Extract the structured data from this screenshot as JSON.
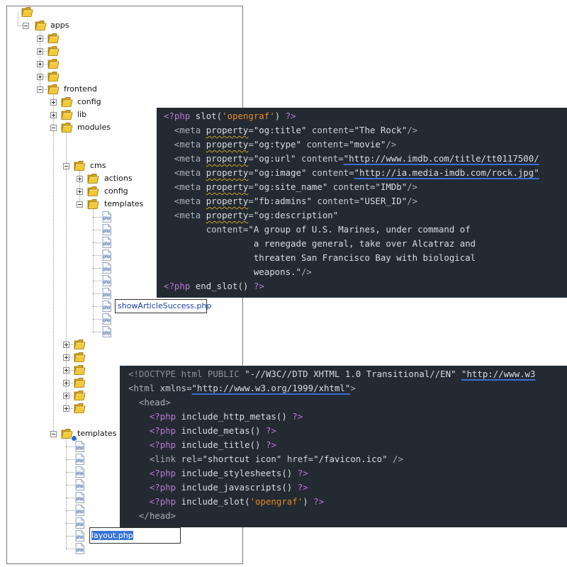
{
  "tree": {
    "root": {
      "icon": "folder-icon"
    },
    "apps": {
      "label": "apps"
    },
    "frontend": {
      "label": "frontend"
    },
    "config": {
      "label": "config"
    },
    "lib": {
      "label": "lib"
    },
    "modules": {
      "label": "modules"
    },
    "cms": {
      "label": "cms"
    },
    "actions": {
      "label": "actions"
    },
    "cms_config": {
      "label": "config"
    },
    "templates": {
      "label": "templates"
    },
    "app_templates": {
      "label": "templates"
    },
    "file_icon_text": "php",
    "edit_show": {
      "value": "showArticleSuccess.php"
    },
    "edit_layout": {
      "value": "layout.php",
      "prefix": "l"
    }
  },
  "code_top": {
    "lines": [
      [
        [
          "kw",
          "<?php"
        ],
        [
          "plain",
          " slot("
        ],
        [
          "str",
          "'opengraf'"
        ],
        [
          "plain",
          ") "
        ],
        [
          "kw",
          "?>"
        ]
      ],
      [
        [
          "plain",
          "  "
        ],
        [
          "tag",
          "<meta "
        ],
        [
          "sq",
          "property"
        ],
        [
          "attr",
          "="
        ],
        [
          "val",
          "\"og:title\""
        ],
        [
          "attr",
          " content="
        ],
        [
          "val",
          "\"The Rock\""
        ],
        [
          "tag",
          "/>"
        ]
      ],
      [
        [
          "plain",
          "  "
        ],
        [
          "tag",
          "<meta "
        ],
        [
          "sq",
          "property"
        ],
        [
          "attr",
          "="
        ],
        [
          "val",
          "\"og:type\""
        ],
        [
          "attr",
          " content="
        ],
        [
          "val",
          "\"movie\""
        ],
        [
          "tag",
          "/>"
        ]
      ],
      [
        [
          "plain",
          "  "
        ],
        [
          "tag",
          "<meta "
        ],
        [
          "sq",
          "property"
        ],
        [
          "attr",
          "="
        ],
        [
          "val",
          "\"og:url\""
        ],
        [
          "attr",
          " content="
        ],
        [
          "url",
          "\"http://www.imdb.com/title/tt0117500/"
        ]
      ],
      [
        [
          "plain",
          "  "
        ],
        [
          "tag",
          "<meta "
        ],
        [
          "sq",
          "property"
        ],
        [
          "attr",
          "="
        ],
        [
          "val",
          "\"og:image\""
        ],
        [
          "attr",
          " content="
        ],
        [
          "url",
          "\"http://ia.media-imdb.com/rock.jpg\""
        ]
      ],
      [
        [
          "plain",
          "  "
        ],
        [
          "tag",
          "<meta "
        ],
        [
          "sq",
          "property"
        ],
        [
          "attr",
          "="
        ],
        [
          "val",
          "\"og:site_name\""
        ],
        [
          "attr",
          " content="
        ],
        [
          "val",
          "\"IMDb\""
        ],
        [
          "tag",
          "/>"
        ]
      ],
      [
        [
          "plain",
          "  "
        ],
        [
          "tag",
          "<meta "
        ],
        [
          "sq",
          "property"
        ],
        [
          "attr",
          "="
        ],
        [
          "val",
          "\"fb:admins\""
        ],
        [
          "attr",
          " content="
        ],
        [
          "val",
          "\"USER_ID\""
        ],
        [
          "tag",
          "/>"
        ]
      ],
      [
        [
          "plain",
          "  "
        ],
        [
          "tag",
          "<meta "
        ],
        [
          "sq",
          "property"
        ],
        [
          "attr",
          "="
        ],
        [
          "val",
          "\"og:description\""
        ]
      ],
      [
        [
          "plain",
          "        "
        ],
        [
          "attr",
          "content="
        ],
        [
          "val",
          "\"A group of U.S. Marines, under command of"
        ]
      ],
      [
        [
          "val",
          "                 a renegade general, take over Alcatraz and"
        ]
      ],
      [
        [
          "val",
          "                 threaten San Francisco Bay with biological"
        ]
      ],
      [
        [
          "val",
          "                 weapons.\""
        ],
        [
          "tag",
          "/>"
        ]
      ],
      [
        [
          "kw",
          "<?php"
        ],
        [
          "plain",
          " end_slot() "
        ],
        [
          "kw",
          "?>"
        ]
      ]
    ]
  },
  "code_bottom": {
    "lines": [
      [
        [
          "doctype",
          "<!DOCTYPE html PUBLIC "
        ],
        [
          "val",
          "\"-//W3C//DTD XHTML 1.0 Transitional//EN\" "
        ],
        [
          "url",
          "\"http://www.w3"
        ]
      ],
      [
        [
          "tag",
          "<html "
        ],
        [
          "attr",
          "xmlns="
        ],
        [
          "url",
          "\"http://www.w3.org/1999/xhtml\""
        ],
        [
          "tag",
          ">"
        ]
      ],
      [
        [
          "plain",
          "  "
        ],
        [
          "tag",
          "<head>"
        ]
      ],
      [
        [
          "plain",
          "    "
        ],
        [
          "kw",
          "<?php"
        ],
        [
          "plain",
          " include_http_metas() "
        ],
        [
          "kw",
          "?>"
        ]
      ],
      [
        [
          "plain",
          "    "
        ],
        [
          "kw",
          "<?php"
        ],
        [
          "plain",
          " include_metas() "
        ],
        [
          "kw",
          "?>"
        ]
      ],
      [
        [
          "plain",
          "    "
        ],
        [
          "kw",
          "<?php"
        ],
        [
          "plain",
          " include_title() "
        ],
        [
          "kw",
          "?>"
        ]
      ],
      [
        [
          "plain",
          "    "
        ],
        [
          "tag",
          "<link "
        ],
        [
          "attr",
          "rel="
        ],
        [
          "val",
          "\"shortcut icon\""
        ],
        [
          "attr",
          " href="
        ],
        [
          "val",
          "\"/favicon.ico\""
        ],
        [
          "tag",
          " />"
        ]
      ],
      [
        [
          "plain",
          "    "
        ],
        [
          "kw",
          "<?php"
        ],
        [
          "plain",
          " include_stylesheets() "
        ],
        [
          "kw",
          "?>"
        ]
      ],
      [
        [
          "plain",
          "    "
        ],
        [
          "kw",
          "<?php"
        ],
        [
          "plain",
          " include_javascripts() "
        ],
        [
          "kw",
          "?>"
        ]
      ],
      [
        [
          "plain",
          "    "
        ],
        [
          "kw",
          "<?php"
        ],
        [
          "plain",
          " include_slot("
        ],
        [
          "str",
          "'opengraf'"
        ],
        [
          "plain",
          ") "
        ],
        [
          "kw",
          "?>"
        ]
      ],
      [
        [
          "plain",
          "  "
        ],
        [
          "tag",
          "</head>"
        ]
      ]
    ]
  }
}
